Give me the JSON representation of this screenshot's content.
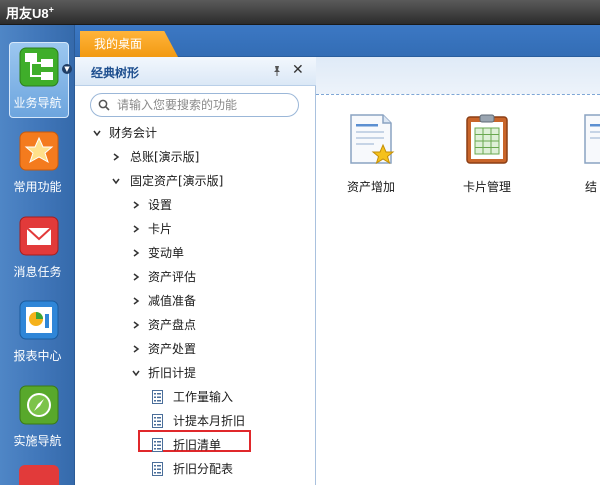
{
  "app": {
    "brand": "用友U8",
    "brand_sup": "+"
  },
  "rail": {
    "items": [
      {
        "label": "业务导航",
        "icon": "business-nav-icon",
        "active": true
      },
      {
        "label": "常用功能",
        "icon": "favorites-star-icon"
      },
      {
        "label": "消息任务",
        "icon": "message-envelope-icon"
      },
      {
        "label": "报表中心",
        "icon": "report-chart-icon"
      },
      {
        "label": "实施导航",
        "icon": "compass-icon"
      }
    ]
  },
  "tabs": [
    {
      "label": "我的桌面",
      "active": true
    }
  ],
  "panel": {
    "title": "经典树形",
    "search_placeholder": "请输入您要搜索的功能",
    "tree": [
      {
        "label": "财务会计",
        "level": 0,
        "state": "expanded"
      },
      {
        "label": "总账[演示版]",
        "level": 1,
        "state": "collapsed"
      },
      {
        "label": "固定资产[演示版]",
        "level": 1,
        "state": "expanded"
      },
      {
        "label": "设置",
        "level": 2,
        "state": "collapsed"
      },
      {
        "label": "卡片",
        "level": 2,
        "state": "collapsed"
      },
      {
        "label": "变动单",
        "level": 2,
        "state": "collapsed"
      },
      {
        "label": "资产评估",
        "level": 2,
        "state": "collapsed"
      },
      {
        "label": "减值准备",
        "level": 2,
        "state": "collapsed"
      },
      {
        "label": "资产盘点",
        "level": 2,
        "state": "collapsed"
      },
      {
        "label": "资产处置",
        "level": 2,
        "state": "collapsed"
      },
      {
        "label": "折旧计提",
        "level": 2,
        "state": "expanded"
      },
      {
        "label": "工作量输入",
        "level": 3,
        "state": "leaf"
      },
      {
        "label": "计提本月折旧",
        "level": 3,
        "state": "leaf"
      },
      {
        "label": "折旧清单",
        "level": 3,
        "state": "leaf",
        "selected": true
      },
      {
        "label": "折旧分配表",
        "level": 3,
        "state": "leaf"
      }
    ]
  },
  "desktop": {
    "items": [
      {
        "label": "资产增加",
        "icon": "asset-add-icon"
      },
      {
        "label": "卡片管理",
        "icon": "card-management-icon"
      },
      {
        "label": "结",
        "icon": "document-icon"
      }
    ]
  },
  "colors": {
    "highlight": "#e0282b",
    "tab": "#f29a12",
    "rail": "#3f75b8"
  }
}
